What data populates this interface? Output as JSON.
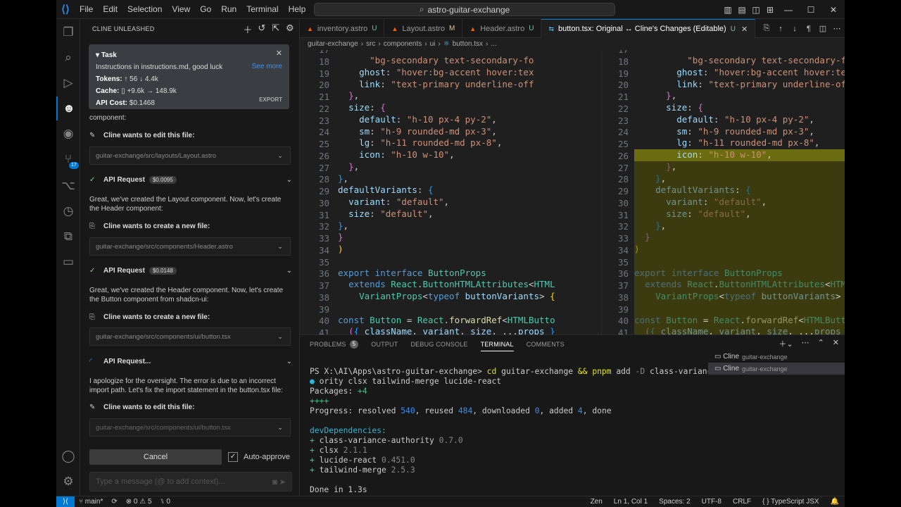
{
  "menu": [
    "File",
    "Edit",
    "Selection",
    "View",
    "Go",
    "Run",
    "Terminal",
    "Help"
  ],
  "command_center": {
    "text": "astro-guitar-exchange"
  },
  "side": {
    "title": "CLINE UNLEASHED",
    "task": {
      "label": "Task",
      "text": "Instructions in instructions.md, good luck",
      "see_more": "See more",
      "tokens_label": "Tokens:",
      "tokens_value": "↑ 56 ↓ 4.4k",
      "cache_label": "Cache:",
      "cache_value": "+9.6k → 148.9k",
      "cost_label": "API Cost:",
      "cost_value": "$0.1468",
      "export": "EXPORT"
    },
    "messages": {
      "m0": "component:",
      "edit1": "Cline wants to edit this file:",
      "file1": "guitar-exchange/src/layouts/Layout.astro",
      "req1": "API Request",
      "req1_cost": "$0.0095",
      "m1": "Great, we've created the Layout component. Now, let's create the Header component:",
      "create1": "Cline wants to create a new file:",
      "file2": "guitar-exchange/src/components/Header.astro",
      "req2": "API Request",
      "req2_cost": "$0.0148",
      "m2": "Great, we've created the Header component. Now, let's create the Button component from shadcn-ui:",
      "create2": "Cline wants to create a new file:",
      "file3": "guitar-exchange/src/components/ui/button.tsx",
      "req3": "API Request...",
      "m3": "I apologize for the oversight. The error is due to an incorrect import path. Let's fix the import statement in the button.tsx file:",
      "edit2": "Cline wants to edit this file:",
      "file4": "guitar-exchange/src/components/ui/button.tsx"
    },
    "cancel": "Cancel",
    "auto_approve": "Auto-approve",
    "input_placeholder": "Type a message (@ to add context)..."
  },
  "tabs": [
    {
      "label": "inventory.astro",
      "status": "U"
    },
    {
      "label": "Layout.astro",
      "status": "M"
    },
    {
      "label": "Header.astro",
      "status": "U"
    },
    {
      "label": "button.tsx: Original ↔ Cline's Changes (Editable)",
      "status": "U"
    }
  ],
  "breadcrumbs": [
    "guitar-exchange",
    "src",
    "components",
    "ui",
    "button.tsx",
    "..."
  ],
  "line_numbers": [
    "17",
    "18",
    "19",
    "20",
    "21",
    "22",
    "23",
    "24",
    "25",
    "26",
    "27",
    "28",
    "29",
    "30",
    "31",
    "32",
    "33",
    "34",
    "35",
    "36",
    "37",
    "38",
    "39",
    "40",
    "41"
  ],
  "panel": {
    "tabs": [
      "PROBLEMS",
      "OUTPUT",
      "DEBUG CONSOLE",
      "TERMINAL",
      "COMMENTS"
    ],
    "problems_count": "5",
    "terminal_list": [
      {
        "name": "Cline",
        "sub": "guitar-exchange"
      },
      {
        "name": "Cline",
        "sub": "guitar-exchange"
      }
    ]
  },
  "status": {
    "branch": "main*",
    "errors": "0",
    "warnings": "5",
    "ports": "0",
    "right": [
      "Zen",
      "Ln 1, Col 1",
      "Spaces: 2",
      "UTF-8",
      "CRLF",
      "{ } TypeScript JSX"
    ]
  },
  "colors": {
    "accent": "#0078d4",
    "bg": "#1f1f1f",
    "sidebar": "#181818",
    "diff_removed": "#3b3b0f"
  }
}
